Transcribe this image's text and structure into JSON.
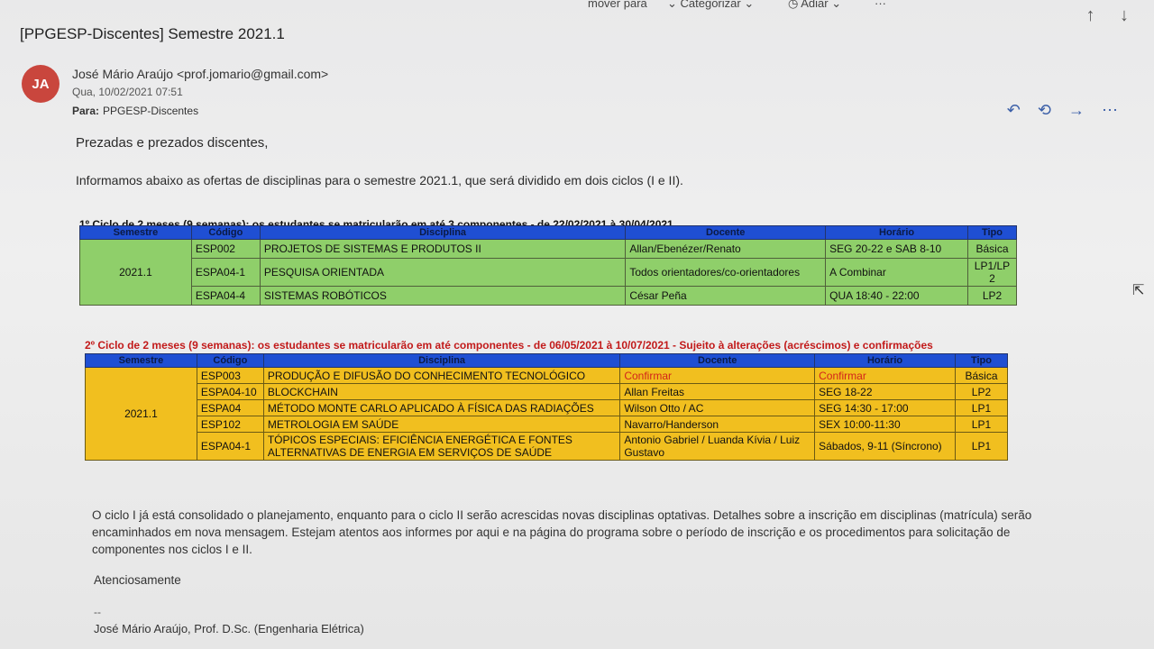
{
  "toolbar": {
    "move_label": "mover para",
    "categorize_label": "Categorizar",
    "snooze_label": "Adiar",
    "more_label": "···"
  },
  "email": {
    "subject": "[PPGESP-Discentes] Semestre 2021.1",
    "avatar_initials": "JA",
    "avatar_color": "#c9463d",
    "sender": "José Mário Araújo <prof.jomario@gmail.com>",
    "date": "Qua, 10/02/2021 07:51",
    "to_label": "Para:",
    "to_value": "PPGESP-Discentes",
    "greeting": "Prezadas e prezados discentes,",
    "intro": "Informamos abaixo as ofertas de disciplinas para o semestre 2021.1, que será dividido em dois ciclos (I e II).",
    "closing": "O ciclo I já está consolidado o planejamento, enquanto para o ciclo II serão acrescidas novas disciplinas optativas. Detalhes sobre a inscrição em disciplinas (matrícula) serão encaminhados em nova mensagem. Estejam atentos aos informes por aqui e na página do programa sobre o período de inscrição e os procedimentos para solicitação de componentes nos ciclos I e II.",
    "regards": "Atenciosamente",
    "sig_dashes": "--",
    "signature": "José Mário Araújo, Prof. D.Sc. (Engenharia Elétrica)"
  },
  "table_headers": {
    "semestre": "Semestre",
    "codigo": "Código",
    "disciplina": "Disciplina",
    "docente": "Docente",
    "horario": "Horário",
    "tipo": "Tipo"
  },
  "cycle1": {
    "title": "1º Ciclo de 2 meses (9 semanas): os estudantes se matricularão em até 3 componentes - de 22/02/2021 à 30/04/2021",
    "semestre": "2021.1",
    "rows": [
      {
        "codigo": "ESP002",
        "disciplina": "PROJETOS DE SISTEMAS E PRODUTOS II",
        "docente": "Allan/Ebenézer/Renato",
        "horario": "SEG 20-22 e SAB 8-10",
        "tipo": "Básica"
      },
      {
        "codigo": "ESPA04-1",
        "disciplina": "PESQUISA ORIENTADA",
        "docente": "Todos orientadores/co-orientadores",
        "horario": "A Combinar",
        "tipo": "LP1/LP 2"
      },
      {
        "codigo": "ESPA04-4",
        "disciplina": "SISTEMAS ROBÓTICOS",
        "docente": "César Peña",
        "horario": "QUA 18:40 - 22:00",
        "tipo": "LP2"
      }
    ]
  },
  "cycle2": {
    "title": "2º Ciclo de 2 meses (9 semanas): os estudantes se matricularão em até componentes - de 06/05/2021 à 10/07/2021 - Sujeito à alterações (acréscimos) e confirmações",
    "semestre": "2021.1",
    "rows": [
      {
        "codigo": "ESP003",
        "disciplina": "PRODUÇÃO E DIFUSÃO DO CONHECIMENTO TECNOLÓGICO",
        "docente": "Confirmar",
        "horario": "Confirmar",
        "tipo": "Básica"
      },
      {
        "codigo": "ESPA04-10",
        "disciplina": "BLOCKCHAIN",
        "docente": "Allan Freitas",
        "horario": "SEG 18-22",
        "tipo": "LP2"
      },
      {
        "codigo": "ESPA04",
        "disciplina": "MÉTODO MONTE CARLO APLICADO À FÍSICA DAS RADIAÇÕES",
        "docente": "Wilson Otto / AC",
        "horario": "SEG 14:30 - 17:00",
        "tipo": "LP1"
      },
      {
        "codigo": "ESP102",
        "disciplina": "METROLOGIA EM SAÚDE",
        "docente": "Navarro/Handerson",
        "horario": "SEX 10:00-11:30",
        "tipo": "LP1"
      },
      {
        "codigo": "ESPA04-1",
        "disciplina": "TÓPICOS ESPECIAIS: EFICIÊNCIA ENERGÉTICA E FONTES ALTERNATIVAS DE ENERGIA EM SERVIÇOS DE SAÚDE",
        "docente": "Antonio Gabriel / Luanda Kívia / Luiz Gustavo",
        "horario": "Sábados, 9-11 (Síncrono)",
        "tipo": "LP1"
      }
    ]
  },
  "colors": {
    "cycle1_bg": "#8fcf6a",
    "cycle2_bg": "#f1bf1f",
    "header_bg": "#1f4fd3",
    "cycle2_title": "#c21a1a",
    "confirm_text": "#d2241b"
  }
}
